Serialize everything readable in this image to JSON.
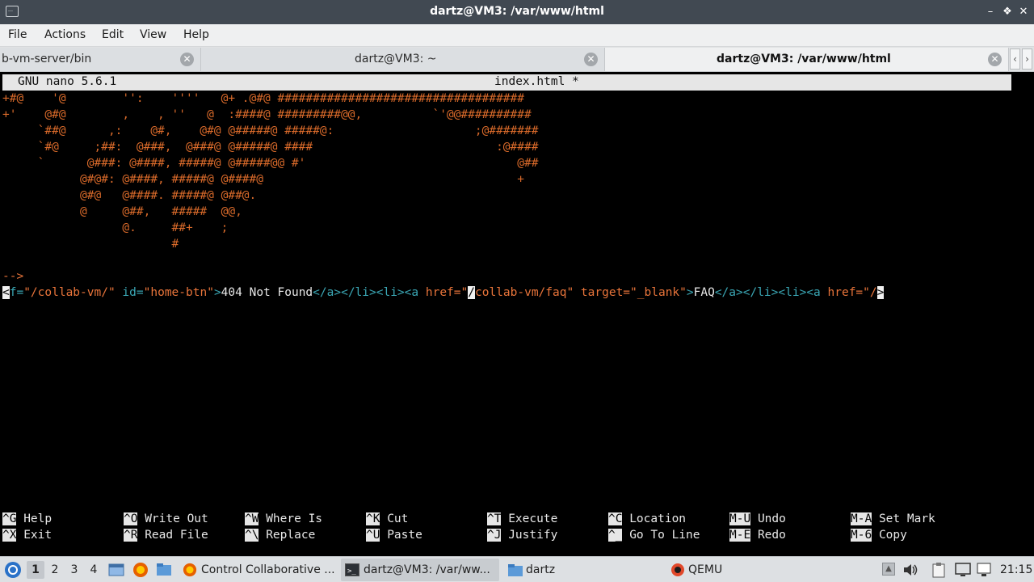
{
  "window": {
    "title": "dartz@VM3: /var/www/html"
  },
  "menu": [
    "File",
    "Actions",
    "Edit",
    "View",
    "Help"
  ],
  "tabs": [
    {
      "label": "b-vm-server/bin"
    },
    {
      "label": "dartz@VM3: ~"
    },
    {
      "label": "dartz@VM3: /var/www/html",
      "active": true
    }
  ],
  "nano": {
    "version": "GNU nano 5.6.1",
    "filename": "index.html *"
  },
  "ascii_art": [
    "+#@    '@        '':    ''''   @+ .@#@ ###################################",
    "+'    @#@        ,    , ''   @  :####@ #########@@,          `'@@##########",
    "     `##@      ,:    @#,    @#@ @#####@ #####@:                    ;@#######",
    "     `#@     ;##:  @###,  @###@ @#####@ ####                          :@####",
    "     `      @###: @####, #####@ @#####@@ #'                              @##",
    "           @#@#: @####, #####@ @####@                                    +",
    "           @#@   @####. #####@ @##@.",
    "           @     @##,   #####  @@,",
    "                 @.     ##+    ;",
    "                        #"
  ],
  "comment_end": "-->",
  "code_line": [
    {
      "t": "<",
      "c": "cursor"
    },
    {
      "t": "f=",
      "c": "c-teal"
    },
    {
      "t": "\"/collab-vm/\"",
      "c": "c-org"
    },
    {
      "t": " id=",
      "c": "c-teal"
    },
    {
      "t": "\"home-btn\"",
      "c": "c-org"
    },
    {
      "t": ">",
      "c": "c-teal"
    },
    {
      "t": "404 Not Found",
      "c": "c-wht"
    },
    {
      "t": "</a></li><li><a ",
      "c": "c-teal"
    },
    {
      "t": "href=",
      "c": "c-org"
    },
    {
      "t": "\"",
      "c": "c-org"
    },
    {
      "t": "/",
      "c": "cursor"
    },
    {
      "t": "collab-vm/faq\"",
      "c": "c-org"
    },
    {
      "t": " target=",
      "c": "c-org"
    },
    {
      "t": "\"_blank\"",
      "c": "c-org"
    },
    {
      "t": ">",
      "c": "c-teal"
    },
    {
      "t": "FAQ",
      "c": "c-wht"
    },
    {
      "t": "</a></li><li><a ",
      "c": "c-teal"
    },
    {
      "t": "href=",
      "c": "c-org"
    },
    {
      "t": "\"/",
      "c": "c-org"
    },
    {
      "t": ">",
      "c": "cursor"
    }
  ],
  "shortcuts_row1": [
    {
      "key": "^G",
      "label": "Help"
    },
    {
      "key": "^O",
      "label": "Write Out"
    },
    {
      "key": "^W",
      "label": "Where Is"
    },
    {
      "key": "^K",
      "label": "Cut"
    },
    {
      "key": "^T",
      "label": "Execute"
    },
    {
      "key": "^C",
      "label": "Location"
    },
    {
      "key": "M-U",
      "label": "Undo"
    },
    {
      "key": "M-A",
      "label": "Set Mark"
    }
  ],
  "shortcuts_row2": [
    {
      "key": "^X",
      "label": "Exit"
    },
    {
      "key": "^R",
      "label": "Read File"
    },
    {
      "key": "^\\",
      "label": "Replace"
    },
    {
      "key": "^U",
      "label": "Paste"
    },
    {
      "key": "^J",
      "label": "Justify"
    },
    {
      "key": "^_",
      "label": "Go To Line"
    },
    {
      "key": "M-E",
      "label": "Redo"
    },
    {
      "key": "M-6",
      "label": "Copy"
    }
  ],
  "taskbar": {
    "workspaces": [
      "1",
      "2",
      "3",
      "4"
    ],
    "tasks": [
      {
        "label": "Control Collaborative ...",
        "icon": "firefox-icon"
      },
      {
        "label": "dartz@VM3: /var/ww...",
        "icon": "terminal-icon",
        "active": true
      },
      {
        "label": "dartz",
        "icon": "folder-icon"
      },
      {
        "label": "QEMU",
        "icon": "qemu-icon"
      }
    ],
    "clock": "21:15"
  }
}
